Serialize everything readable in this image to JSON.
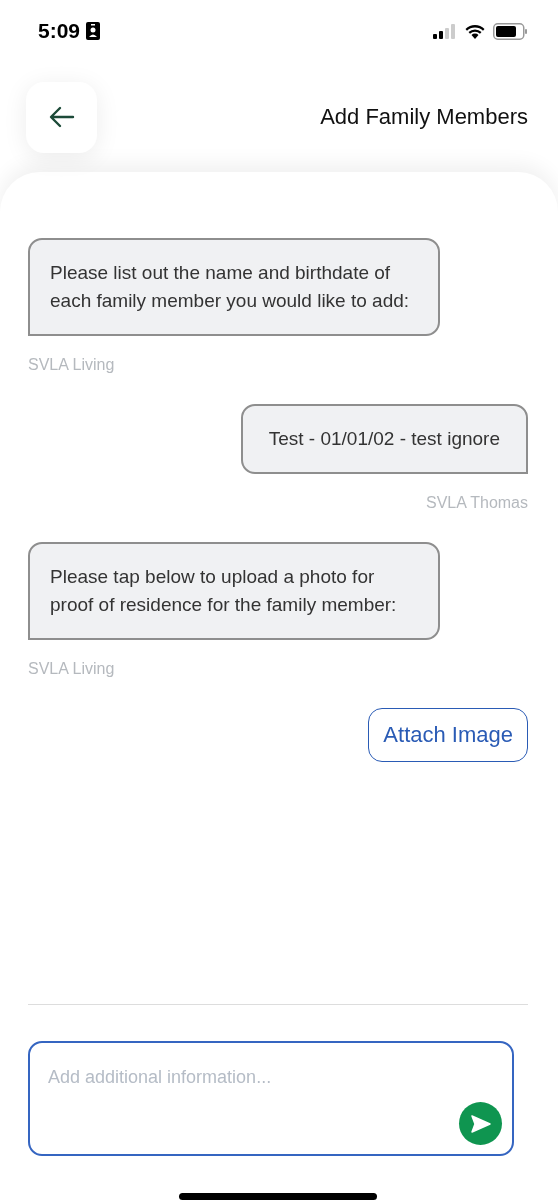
{
  "status_bar": {
    "time": "5:09"
  },
  "header": {
    "title": "Add Family Members"
  },
  "messages": [
    {
      "kind": "left",
      "text": "Please list out the name and birthdate of each family member you would like to add:",
      "sender": "SVLA Living"
    },
    {
      "kind": "right",
      "text": "Test - 01/01/02 - test ignore",
      "sender": "SVLA Thomas"
    },
    {
      "kind": "left",
      "text": "Please tap below to upload a photo for proof of residence for the family member:",
      "sender": "SVLA Living"
    }
  ],
  "attach_button": {
    "label": "Attach Image"
  },
  "composer": {
    "placeholder": "Add additional information..."
  }
}
